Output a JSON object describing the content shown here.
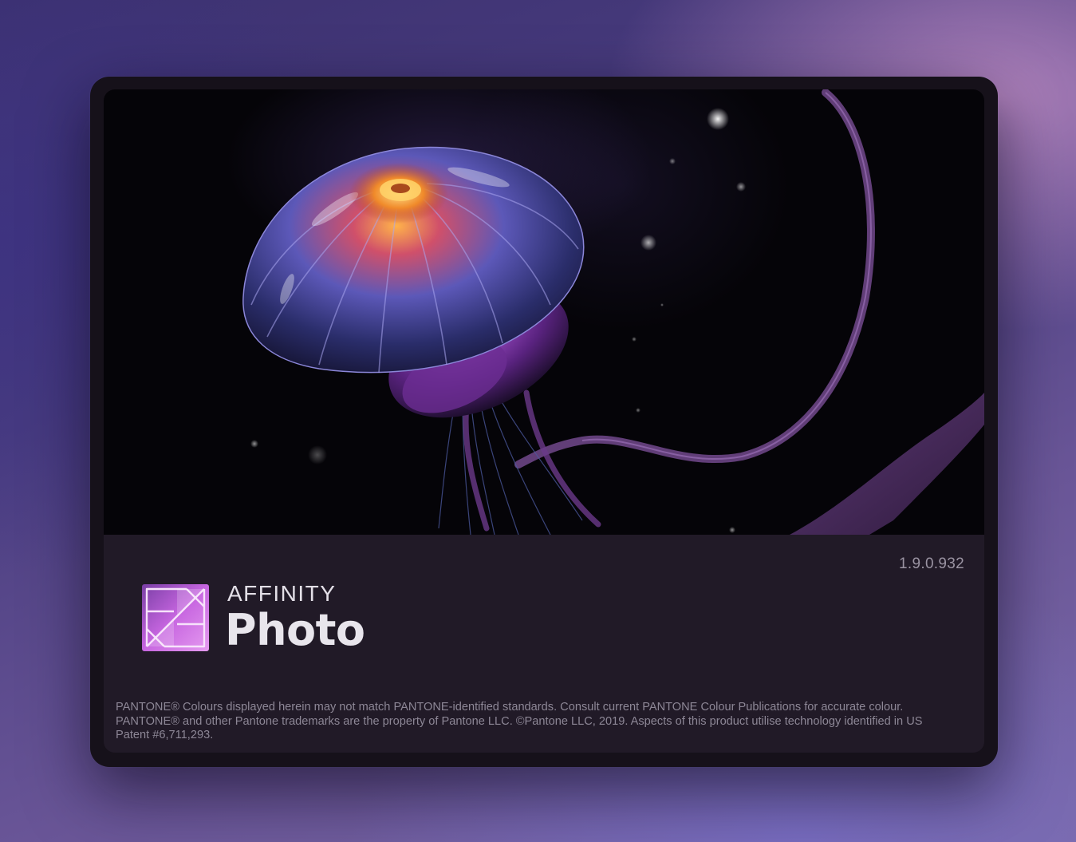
{
  "splash": {
    "version": "1.9.0.932",
    "brand_top": "AFFINITY",
    "brand_main": "Photo",
    "legal": "PANTONE® Colours displayed herein may not match PANTONE-identified standards. Consult current PANTONE Colour Publications for accurate colour. PANTONE® and other Pantone trademarks are the property of Pantone LLC. ©Pantone LLC, 2019. Aspects of this product utilise technology identified in US Patent #6,711,293.",
    "artwork_icon": "jellyfish-artwork",
    "logo_icon": "affinity-photo-logo-icon"
  },
  "colors": {
    "accent": "#c766e0",
    "panel": "#211a27",
    "frame": "#16111a"
  }
}
